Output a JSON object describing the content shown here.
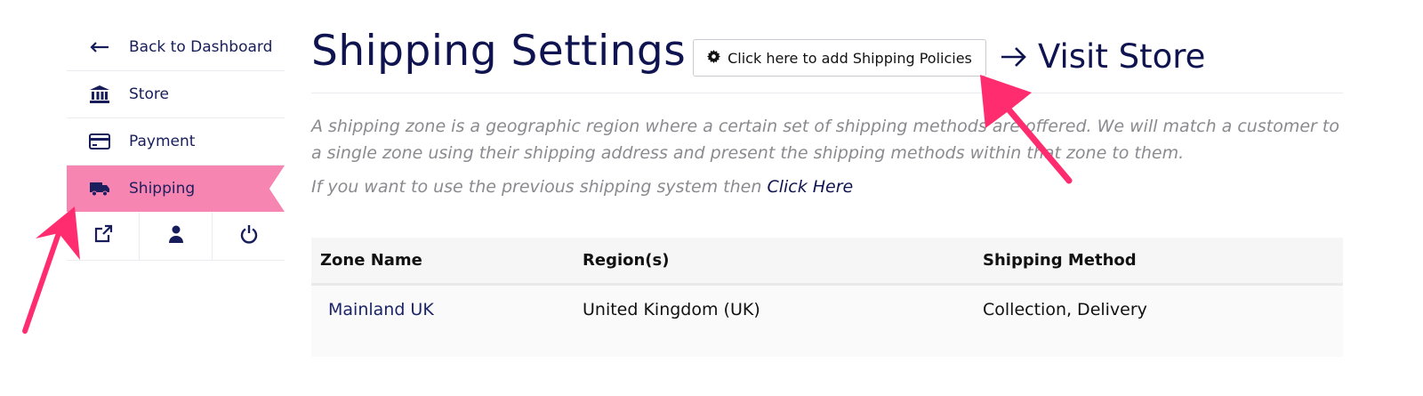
{
  "sidebar": {
    "items": [
      {
        "icon": "arrow-left-icon",
        "label": "Back to Dashboard"
      },
      {
        "icon": "bank-icon",
        "label": "Store"
      },
      {
        "icon": "credit-card-icon",
        "label": "Payment"
      },
      {
        "icon": "truck-icon",
        "label": "Shipping",
        "active": true
      }
    ],
    "actions": [
      "external-link-icon",
      "user-icon",
      "power-icon"
    ]
  },
  "header": {
    "title": "Shipping Settings",
    "policy_button": "Click here to add Shipping Policies",
    "visit_store": "Visit Store"
  },
  "description": {
    "text": "A shipping zone is a geographic region where a certain set of shipping methods are offered. We will match a customer to a single zone using their shipping address and present the shipping methods within that zone to them.",
    "legacy_prefix": "If you want to use the previous shipping system then ",
    "legacy_link": "Click Here"
  },
  "table": {
    "columns": [
      "Zone Name",
      "Region(s)",
      "Shipping Method"
    ],
    "rows": [
      {
        "zone": "Mainland UK",
        "region": "United Kingdom (UK)",
        "method": "Collection, Delivery"
      }
    ]
  },
  "colors": {
    "accent_pink": "#f785b1",
    "annotation_arrow": "#ff2d6f",
    "navy": "#0f1450"
  }
}
